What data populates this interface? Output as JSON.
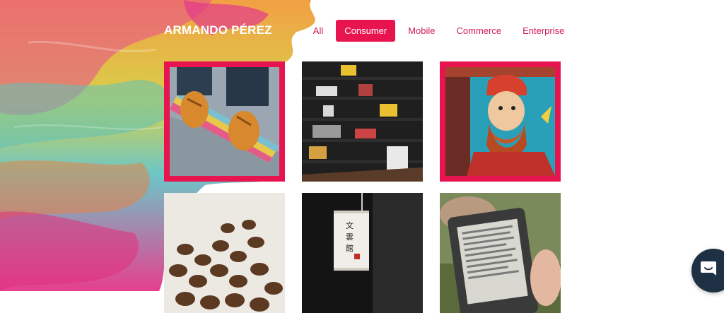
{
  "header": {
    "brand": "ARMANDO PÉREZ"
  },
  "nav": {
    "items": [
      {
        "label": "All"
      },
      {
        "label": "Consumer",
        "active": true
      },
      {
        "label": "Mobile"
      },
      {
        "label": "Commerce"
      },
      {
        "label": "Enterprise"
      }
    ]
  },
  "gallery": {
    "tiles": [
      {
        "subject": "skateboard-shoes",
        "highlighted": true
      },
      {
        "subject": "bookshelf",
        "highlighted": false
      },
      {
        "subject": "bearded-man-mural",
        "highlighted": true
      },
      {
        "subject": "coffee-beans",
        "highlighted": false
      },
      {
        "subject": "paper-lantern",
        "highlighted": false
      },
      {
        "subject": "e-reader",
        "highlighted": false
      }
    ]
  },
  "icons": {
    "chat": "chat-bubble-icon"
  },
  "colors": {
    "accent": "#e8144f",
    "nav_text": "#d21b57",
    "chat_button": "#1e3044"
  }
}
